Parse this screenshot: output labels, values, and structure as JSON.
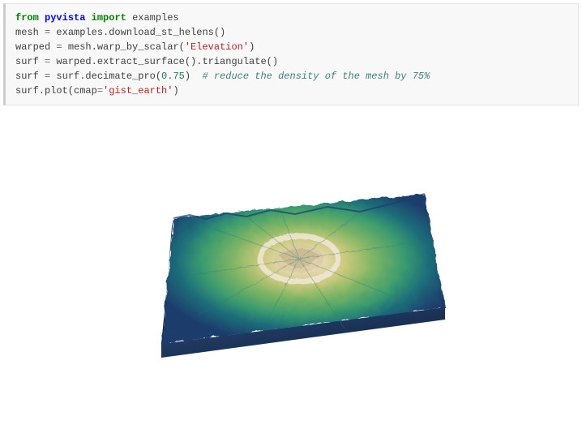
{
  "code": {
    "l1_from": "from",
    "l1_mod": "pyvista",
    "l1_import": "import",
    "l1_name": "examples",
    "l2_lhs": "mesh",
    "l2_eq": " = ",
    "l2_rhs": "examples.download_st_helens()",
    "l3_lhs": "warped",
    "l3_eq": " = ",
    "l3_call": "mesh.warp_by_scalar(",
    "l3_str": "'Elevation'",
    "l3_close": ")",
    "l4_lhs": "surf",
    "l4_eq": " = ",
    "l4_rhs": "warped.extract_surface().triangulate()",
    "l5_lhs": "surf",
    "l5_eq": " = ",
    "l5_call": "surf.decimate_pro(",
    "l5_num": "0.75",
    "l5_close": ")",
    "l5_pad": "  ",
    "l5_comment": "# reduce the density of the mesh by 75%",
    "l6_call": "surf.plot(cmap",
    "l6_eq2": "=",
    "l6_str": "'gist_earth'",
    "l6_close": ")"
  },
  "plot": {
    "colormap": "gist_earth",
    "dataset": "st_helens",
    "scalar": "Elevation",
    "colors": {
      "low": "#1a2e5c",
      "mid_low": "#1e5e7a",
      "mid": "#3a9b6e",
      "mid_high": "#a8c25e",
      "high": "#e8d9b5",
      "peak": "#f5f0e8"
    }
  }
}
